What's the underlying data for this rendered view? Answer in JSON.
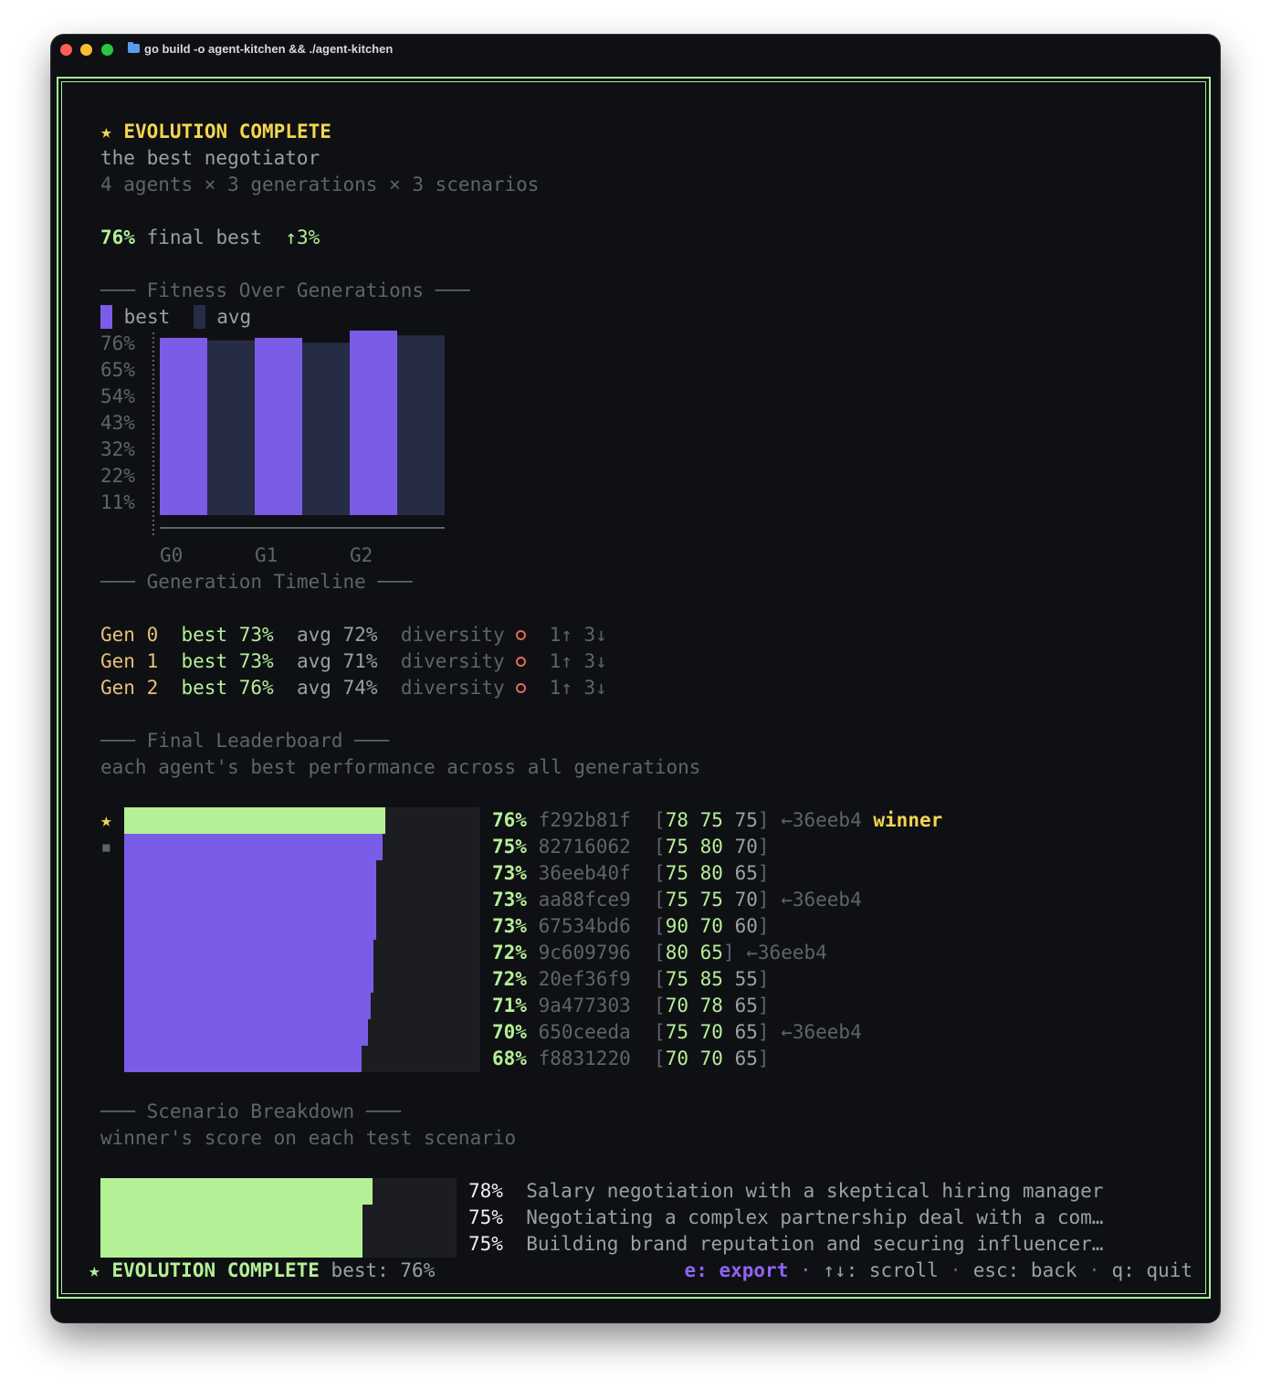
{
  "window": {
    "title": "go build -o agent-kitchen && ./agent-kitchen"
  },
  "header": {
    "star": "★",
    "title": "EVOLUTION COMPLETE",
    "subtitle": "the best negotiator",
    "meta": "4 agents × 3 generations × 3 scenarios",
    "final_pct": "76%",
    "final_label": "final best",
    "delta": "↑3%"
  },
  "sections": {
    "fitness": "─── Fitness Over Generations ───",
    "timeline": "─── Generation Timeline ───",
    "leaderboard": "─── Final Leaderboard ───",
    "leaderboard_sub": "each agent's best performance across all generations",
    "scenario": "─── Scenario Breakdown ───",
    "scenario_sub": "winner's score on each test scenario"
  },
  "chart_data": {
    "type": "bar",
    "title": "Fitness Over Generations",
    "categories": [
      "G0",
      "G1",
      "G2"
    ],
    "series": [
      {
        "name": "best",
        "values": [
          73,
          73,
          76
        ],
        "color": "#7b5ce6"
      },
      {
        "name": "avg",
        "values": [
          72,
          71,
          74
        ],
        "color": "#262c44"
      }
    ],
    "yticks": [
      "76%",
      "65%",
      "54%",
      "43%",
      "32%",
      "22%",
      "11%"
    ],
    "ylim": [
      0,
      76
    ],
    "legend_placement": "top-left",
    "grid": false
  },
  "timeline": [
    {
      "gen": "Gen 0",
      "best_label": "best",
      "best": "73%",
      "avg_label": "avg",
      "avg": "72%",
      "div_label": "diversity",
      "moves": "1↑ 3↓"
    },
    {
      "gen": "Gen 1",
      "best_label": "best",
      "best": "73%",
      "avg_label": "avg",
      "avg": "71%",
      "div_label": "diversity",
      "moves": "1↑ 3↓"
    },
    {
      "gen": "Gen 2",
      "best_label": "best",
      "best": "76%",
      "avg_label": "avg",
      "avg": "74%",
      "div_label": "diversity",
      "moves": "1↑ 3↓"
    }
  ],
  "leaderboard": {
    "marker_winner": "★",
    "marker_second": "▪",
    "winner_label": "winner",
    "rows": [
      {
        "pct": "76%",
        "value": 76,
        "id": "f292b81f",
        "s1": "78",
        "s2": "75",
        "s3": "75",
        "parent": "←36eeb4"
      },
      {
        "pct": "75%",
        "value": 75,
        "id": "82716062",
        "s1": "75",
        "s2": "80",
        "s3": "70",
        "parent": ""
      },
      {
        "pct": "73%",
        "value": 73,
        "id": "36eeb40f",
        "s1": "75",
        "s2": "80",
        "s3": "65",
        "parent": ""
      },
      {
        "pct": "73%",
        "value": 73,
        "id": "aa88fce9",
        "s1": "75",
        "s2": "75",
        "s3": "70",
        "parent": "←36eeb4"
      },
      {
        "pct": "73%",
        "value": 73,
        "id": "67534bd6",
        "s1": "90",
        "s2": "70",
        "s3": "60",
        "parent": ""
      },
      {
        "pct": "72%",
        "value": 72,
        "id": "9c609796",
        "s1": "80",
        "s2": "65",
        "s3": "",
        "parent": "←36eeb4"
      },
      {
        "pct": "72%",
        "value": 72,
        "id": "20ef36f9",
        "s1": "75",
        "s2": "85",
        "s3": "55",
        "parent": ""
      },
      {
        "pct": "71%",
        "value": 71,
        "id": "9a477303",
        "s1": "70",
        "s2": "78",
        "s3": "65",
        "parent": ""
      },
      {
        "pct": "70%",
        "value": 70,
        "id": "650ceeda",
        "s1": "75",
        "s2": "70",
        "s3": "65",
        "parent": "←36eeb4"
      },
      {
        "pct": "68%",
        "value": 68,
        "id": "f8831220",
        "s1": "70",
        "s2": "70",
        "s3": "65",
        "parent": ""
      }
    ]
  },
  "scenarios": [
    {
      "pct": "78%",
      "value": 78,
      "label": "Salary negotiation with a skeptical hiring manager"
    },
    {
      "pct": "75%",
      "value": 75,
      "label": "Negotiating a complex partnership deal with a com…"
    },
    {
      "pct": "75%",
      "value": 75,
      "label": "Building brand reputation and securing influencer…"
    }
  ],
  "statusbar": {
    "star": "★",
    "title": "EVOLUTION COMPLETE",
    "best": "best: 76%",
    "export_key": "e: export",
    "sep": "·",
    "scroll": "↑↓: scroll",
    "back": "esc: back",
    "quit": "q: quit"
  },
  "colors": {
    "border": "#a6f29a",
    "accent_green": "#b4f096",
    "purple": "#7b5ce6",
    "avg_bar": "#262c44",
    "yellow": "#f2d64f"
  }
}
